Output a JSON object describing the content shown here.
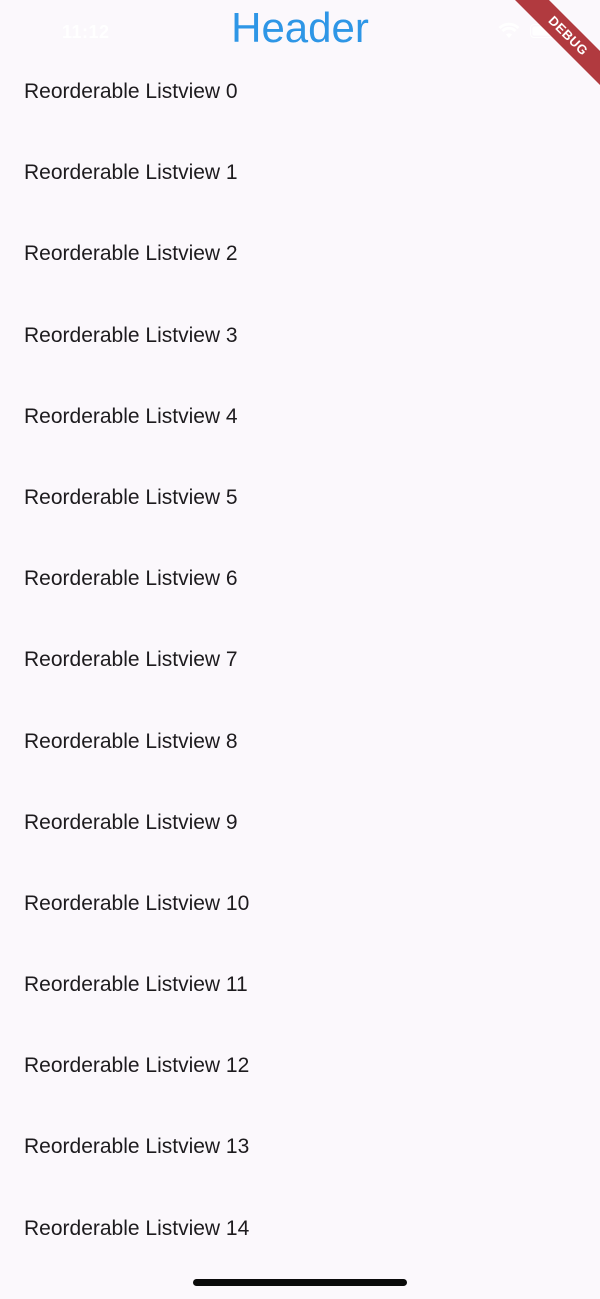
{
  "status_bar": {
    "time": "11:12"
  },
  "header": {
    "title": "Header",
    "color": "#2e96e6"
  },
  "debug_banner": {
    "label": "DEBUG",
    "color": "#b13a3f"
  },
  "list": {
    "items": [
      {
        "label": "Reorderable Listview 0"
      },
      {
        "label": "Reorderable Listview 1"
      },
      {
        "label": "Reorderable Listview 2"
      },
      {
        "label": "Reorderable Listview 3"
      },
      {
        "label": "Reorderable Listview 4"
      },
      {
        "label": "Reorderable Listview 5"
      },
      {
        "label": "Reorderable Listview 6"
      },
      {
        "label": "Reorderable Listview 7"
      },
      {
        "label": "Reorderable Listview 8"
      },
      {
        "label": "Reorderable Listview 9"
      },
      {
        "label": "Reorderable Listview 10"
      },
      {
        "label": "Reorderable Listview 11"
      },
      {
        "label": "Reorderable Listview 12"
      },
      {
        "label": "Reorderable Listview 13"
      },
      {
        "label": "Reorderable Listview 14"
      }
    ]
  },
  "icons": {
    "wifi": "wifi-icon",
    "battery": "battery-icon"
  },
  "colors": {
    "background": "#fbf8fc",
    "text": "#1d1b1e"
  }
}
